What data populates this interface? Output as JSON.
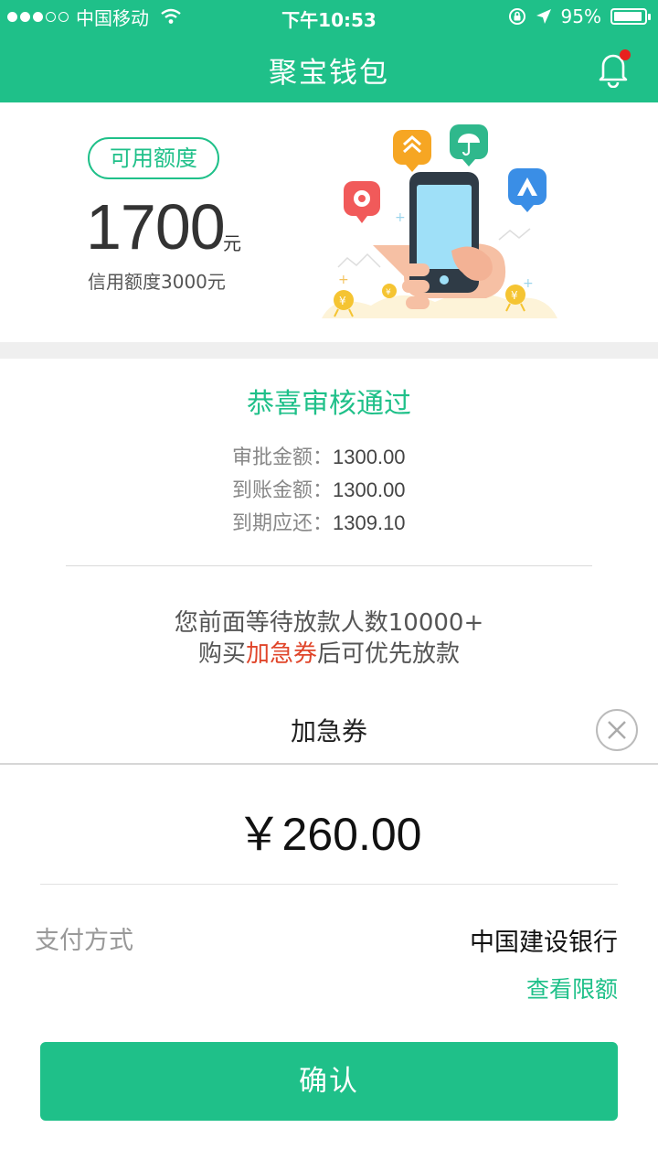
{
  "status_bar": {
    "carrier": "中国移动",
    "time": "下午10:53",
    "battery": "95%",
    "battery_level": 0.95
  },
  "nav": {
    "title": "聚宝钱包"
  },
  "credit": {
    "badge": "可用额度",
    "amount": "1700",
    "unit": "元",
    "total": "信用额度3000元"
  },
  "approval": {
    "title": "恭喜审核通过",
    "rows": [
      {
        "label": "审批金额：",
        "value": "1300.00"
      },
      {
        "label": "到账金额：",
        "value": "1300.00"
      },
      {
        "label": "到期应还：",
        "value": "1309.10"
      }
    ]
  },
  "queue": {
    "line1": "您前面等待放款人数10000+",
    "line2_prefix": "购买",
    "line2_highlight": "加急券",
    "line2_suffix": "后可优先放款"
  },
  "sheet": {
    "title": "加急券",
    "amount": "￥260.00",
    "pay_label": "支付方式",
    "pay_bank": "中国建设银行",
    "limit_link": "查看限额",
    "confirm_label": "确认"
  },
  "colors": {
    "brand_green": "#1fc089",
    "highlight_red": "#e0452a"
  }
}
